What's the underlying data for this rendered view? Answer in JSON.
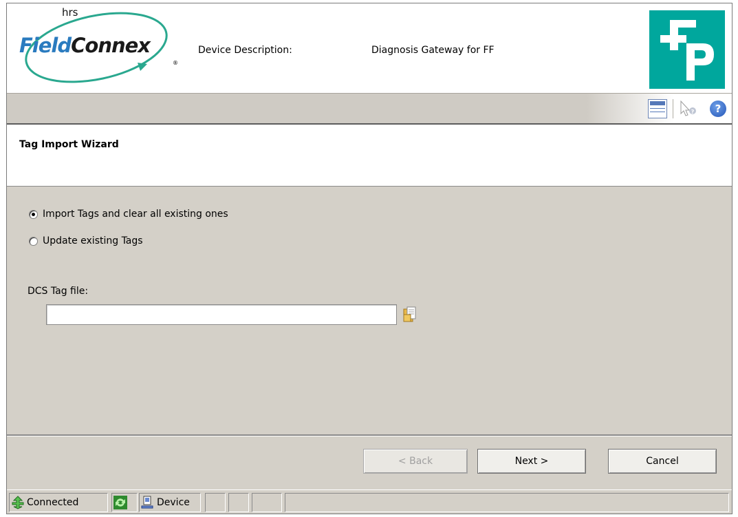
{
  "header": {
    "logo_text_part1": "Field",
    "logo_text_part2": "Connex",
    "logo_mark": "hrs",
    "logo_registered": "®",
    "device_description_label": "Device Description:",
    "device_description_value": "Diagnosis Gateway for FF"
  },
  "toolbar": {
    "icons": [
      "window-layout-icon",
      "whats-this-icon",
      "help-icon"
    ],
    "help_glyph": "?"
  },
  "wizard": {
    "title": "Tag Import Wizard",
    "options": [
      {
        "label": "Import Tags and clear all existing ones",
        "checked": true
      },
      {
        "label": "Update existing Tags",
        "checked": false
      }
    ],
    "dcs_tag_file_label": "DCS Tag file:",
    "dcs_tag_file_value": ""
  },
  "buttons": {
    "back": "< Back",
    "next": "Next >",
    "cancel": "Cancel"
  },
  "statusbar": {
    "connected": "Connected",
    "device": "Device"
  },
  "colors": {
    "brand_teal": "#00a79d",
    "brand_blue": "#2a7bbf",
    "panel_gray": "#d4d0c8"
  }
}
